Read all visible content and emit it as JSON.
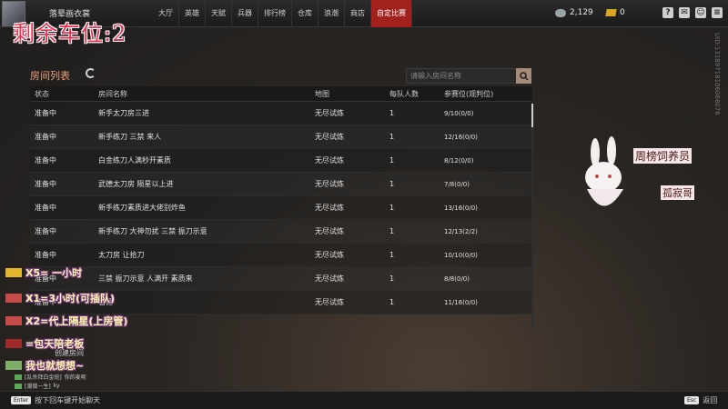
{
  "header": {
    "player_name": "落晕画衣裳",
    "nav": [
      "大厅",
      "英雄",
      "天赋",
      "兵器",
      "排行榜",
      "仓库",
      "浪潮",
      "商店",
      "自定比赛"
    ],
    "active_nav_index": 8,
    "silver_amount": "2,129",
    "gold_amount": "0"
  },
  "overlay": {
    "title": "剩余车位:2",
    "gift_lines": [
      "X5= 一小时",
      "X1=3小时(可插队)",
      "X2=代上隔星(上房管)",
      "=包天陪老板",
      "我也就想想~"
    ],
    "mascot_role": "周榜饲养员",
    "mascot_name": "孤寂哥"
  },
  "watermark": "UID:13189718106068076",
  "room_list": {
    "title": "房间列表",
    "search_placeholder": "请输入房间名称",
    "columns": [
      "状态",
      "房间名称",
      "地图",
      "每队人数",
      "参赛位(观判位)"
    ],
    "rows": [
      {
        "status": "准备中",
        "name": "新手太刀房三进",
        "map": "无尽试炼",
        "players": "1",
        "slots": "9/10(0/0)"
      },
      {
        "status": "准备中",
        "name": "新手练刀 三禁 来人",
        "map": "无尽试炼",
        "players": "1",
        "slots": "12/16(0/0)"
      },
      {
        "status": "准备中",
        "name": "白金练刀人满秒开素质",
        "map": "无尽试炼",
        "players": "1",
        "slots": "8/12(0/0)"
      },
      {
        "status": "准备中",
        "name": "武德太刀房 陨星以上进",
        "map": "无尽试炼",
        "players": "1",
        "slots": "7/8(0/0)"
      },
      {
        "status": "准备中",
        "name": "新手练刀素质进大佬别炸鱼",
        "map": "无尽试炼",
        "players": "1",
        "slots": "13/16(0/0)"
      },
      {
        "status": "准备中",
        "name": "新手练刀 大神勿扰 三禁 振刀示意",
        "map": "无尽试炼",
        "players": "1",
        "slots": "12/13(2/2)"
      },
      {
        "status": "准备中",
        "name": "太刀房 让拾刀",
        "map": "无尽试炼",
        "players": "1",
        "slots": "10/10(0/0)"
      },
      {
        "status": "准备中",
        "name": "三禁 振刀示意 人满开 素质来",
        "map": "无尽试炼",
        "players": "1",
        "slots": "8/8(0/0)"
      },
      {
        "status": "准备中",
        "name": "石锤",
        "map": "无尽试炼",
        "players": "1",
        "slots": "11/16(0/0)"
      }
    ]
  },
  "create_room_label": "创建房间",
  "chat": [
    {
      "channel": "[乱杀拜白金班]",
      "text": "你的麦呢"
    },
    {
      "channel": "[潮僧一生]",
      "text": "ky"
    }
  ],
  "footer": {
    "enter_key": "Enter",
    "enter_hint": "按下回车键开始聊天",
    "esc_key": "Esc",
    "back_label": "返回"
  },
  "colors": {
    "active_tab": "#a3211d",
    "title_overlay": "#e6314f",
    "panel_title": "#e89c7a"
  }
}
